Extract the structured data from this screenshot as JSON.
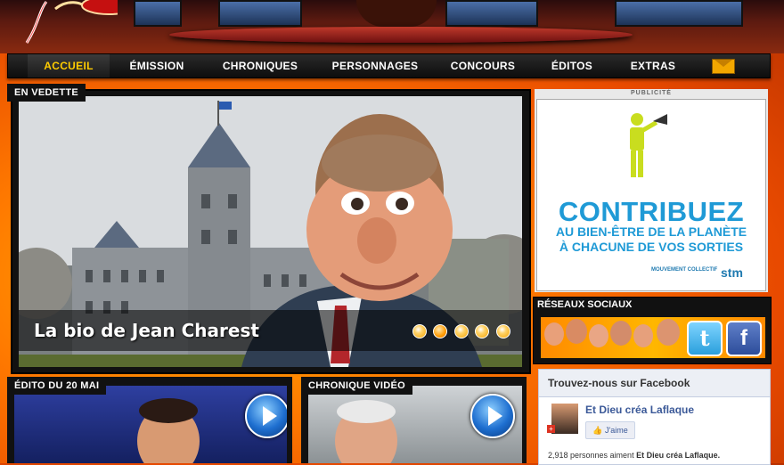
{
  "nav": {
    "items": [
      "ACCUEIL",
      "ÉMISSION",
      "CHRONIQUES",
      "PERSONNAGES",
      "CONCOURS",
      "ÉDITOS",
      "EXTRAS"
    ],
    "active": "ACCUEIL",
    "mail_icon": "envelope-icon"
  },
  "featured": {
    "tag": "EN VEDETTE",
    "caption": "La bio de Jean Charest",
    "slides_total": 5,
    "active_slide": 2
  },
  "ad": {
    "label": "PUBLICITÉ",
    "headline": "CONTRIBUEZ",
    "line1": "AU BIEN-ÊTRE DE LA PLANÈTE",
    "line2": "À CHACUNE DE VOS SORTIES",
    "footer_small": "MOUVEMENT COLLECTIF",
    "brand": "stm",
    "accent": "#1f9ad6",
    "figure_color": "#c9dd1f"
  },
  "social": {
    "tag": "RÉSEAUX SOCIAUX",
    "twitter_glyph": "t",
    "facebook_glyph": "f"
  },
  "edito": {
    "tag": "ÉDITO DU 20 MAI"
  },
  "chronique": {
    "tag": "CHRONIQUE VIDÉO"
  },
  "facebook_box": {
    "title": "Trouvez-nous sur Facebook",
    "page_name": "Et Dieu créa Laflaque",
    "like_label": "J'aime",
    "count_text": "2,918 personnes aiment",
    "count_page": "Et Dieu créa Laflaque."
  },
  "colors": {
    "nav_active": "#ffcc00",
    "fb_blue": "#3b5998"
  }
}
